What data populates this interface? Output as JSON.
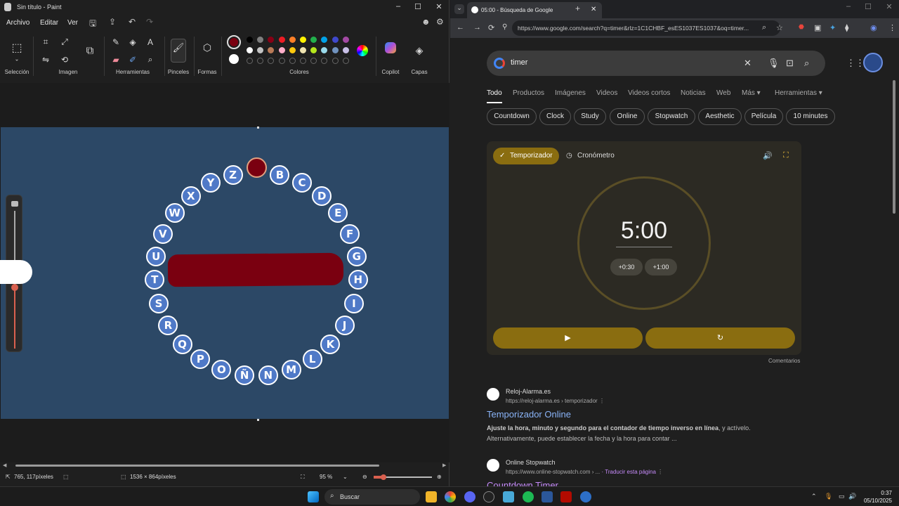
{
  "paint": {
    "title": "Sin título - Paint",
    "menu": [
      "Archivo",
      "Editar",
      "Ver"
    ],
    "groups": [
      "Selección",
      "Imagen",
      "Herramientas",
      "Pinceles",
      "Formas",
      "Colores",
      "Copilot",
      "Capas"
    ],
    "letters": [
      "B",
      "C",
      "D",
      "E",
      "F",
      "G",
      "H",
      "I",
      "J",
      "K",
      "L",
      "M",
      "N",
      "Ñ",
      "O",
      "P",
      "Q",
      "R",
      "S",
      "T",
      "U",
      "V",
      "W",
      "X",
      "Y",
      "Z"
    ],
    "status": {
      "pointer": "765, 117píxeles",
      "canvas_size": "1536 × 864píxeles",
      "zoom": "95 %"
    },
    "colors": {
      "row1": [
        "#000000",
        "#7f7f7f",
        "#880015",
        "#ed1c24",
        "#ff7f27",
        "#fff200",
        "#22b14c",
        "#00a2e8",
        "#3f48cc",
        "#a349a4"
      ],
      "row2": [
        "#ffffff",
        "#c3c3c3",
        "#b97a57",
        "#ffaec9",
        "#ffc90e",
        "#efe4b0",
        "#b5e61d",
        "#99d9ea",
        "#7092be",
        "#c8bfe7"
      ],
      "primary": "#7a0010",
      "canvas_bg": "#2c4866",
      "stroke": "#7a0010"
    }
  },
  "chrome": {
    "tab_title": "05:00 - Búsqueda de Google",
    "url": "https://www.google.com/search?q=timer&rlz=1C1CHBF_esES1037ES1037&oq=timer...",
    "query": "timer",
    "tabs": [
      "Todo",
      "Productos",
      "Imágenes",
      "Videos",
      "Videos cortos",
      "Noticias",
      "Web",
      "Más ▾",
      "Herramientas ▾"
    ],
    "chips": [
      "Countdown",
      "Clock",
      "Study",
      "Online",
      "Stopwatch",
      "Aesthetic",
      "Película",
      "10 minutes"
    ],
    "timer": {
      "tab_timer": "Temporizador",
      "tab_stopwatch": "Cronómetro",
      "time": "5:00",
      "add30": "+0:30",
      "add60": "+1:00",
      "comments": "Comentarios"
    },
    "results": [
      {
        "site": "Reloj-Alarma.es",
        "url": "https://reloj-alarma.es › temporizador",
        "title": "Temporizador Online",
        "snippet_bold": "Ajuste la hora, minuto y segundo para el contador de tiempo inverso en línea",
        "snippet": ", y actívelo. Alternativamente, puede establecer la fecha y la hora para contar ..."
      },
      {
        "site": "Online Stopwatch",
        "url": "https://www.online-stopwatch.com › ...",
        "translate": "· Traducir esta página",
        "title": "Countdown Timer"
      }
    ]
  },
  "taskbar": {
    "search": "Buscar",
    "time": "0:37",
    "date": "05/10/2025"
  }
}
